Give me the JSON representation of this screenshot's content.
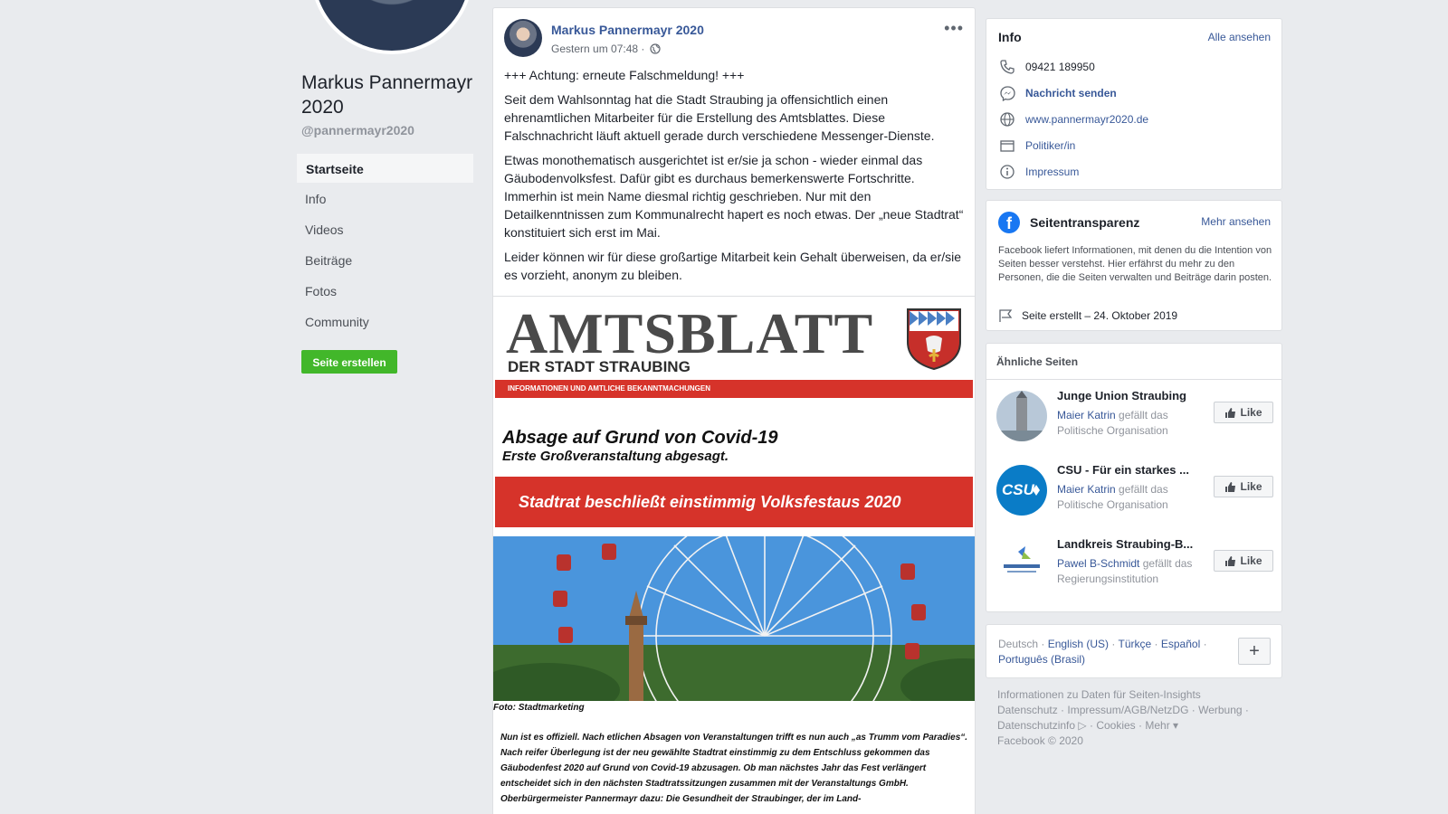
{
  "profile": {
    "name": "Markus Pannermayr 2020",
    "handle": "@pannermayr2020",
    "nav": [
      {
        "label": "Startseite",
        "active": true
      },
      {
        "label": "Info",
        "active": false
      },
      {
        "label": "Videos",
        "active": false
      },
      {
        "label": "Beiträge",
        "active": false
      },
      {
        "label": "Fotos",
        "active": false
      },
      {
        "label": "Community",
        "active": false
      }
    ],
    "create_page_label": "Seite erstellen"
  },
  "post": {
    "author": "Markus Pannermayr 2020",
    "time": "Gestern um 07:48 ·",
    "more_icon": "more-dots-icon",
    "paragraphs": [
      "+++ Achtung: erneute Falschmeldung! +++",
      "Seit dem Wahlsonntag hat die Stadt Straubing ja offensichtlich einen ehrenamtlichen Mitarbeiter für die Erstellung des Amtsblattes. Diese Falschnachricht läuft aktuell gerade durch verschiedene Messenger-Dienste.",
      "Etwas monothematisch ausgerichtet ist er/sie ja schon - wieder einmal das Gäubodenvolksfest. Dafür gibt es durchaus bemerkenswerte Fortschritte. Immerhin ist mein Name diesmal richtig geschrieben. Nur mit den Detailkenntnissen zum Kommunalrecht hapert es noch etwas. Der „neue Stadtrat“ konstituiert sich erst im Mai.",
      "Leider können wir für diese großartige Mitarbeit kein Gehalt überweisen, da er/sie es vorzieht, anonym zu bleiben."
    ],
    "image": {
      "title": "AMTSBLATT",
      "subtitle": "DER STADT STRAUBING",
      "band": "INFORMATIONEN UND AMTLICHE BEKANNTMACHUNGEN",
      "headline": "Absage auf Grund von Covid-19",
      "subline": "Erste Großveranstaltung abgesagt.",
      "banner": "Stadtrat beschließt einstimmig Volksfestaus 2020",
      "caption": "Foto: Stadtmarketing",
      "body": "Nun ist es offiziell. Nach etlichen Absagen von Veranstaltungen trifft es nun auch „as Trumm vom Paradies“. Nach reifer Überlegung ist der neu gewählte Stadtrat einstimmig zu dem Entschluss gekommen das Gäubodenfest 2020 auf Grund von Covid-19 abzusagen. Ob man nächstes Jahr das Fest verlängert entscheidet sich in den nächsten Stadtratssitzungen zusammen mit der Veranstaltungs GmbH. Oberbürgermeister Pannermayr dazu: Die Gesundheit der Straubinger, der im Land-"
    }
  },
  "info": {
    "title": "Info",
    "see_all": "Alle ansehen",
    "rows": [
      {
        "icon": "phone-icon",
        "text": "09421 189950"
      },
      {
        "icon": "messenger-icon",
        "text": "Nachricht senden"
      },
      {
        "icon": "globe-icon",
        "text": "www.pannermayr2020.de"
      },
      {
        "icon": "category-icon",
        "text": "Politiker/in"
      },
      {
        "icon": "info-icon",
        "text": "Impressum"
      }
    ]
  },
  "transparency": {
    "title": "Seitentransparenz",
    "more": "Mehr ansehen",
    "text": "Facebook liefert Informationen, mit denen du die Intention von Seiten besser verstehst. Hier erfährst du mehr zu den Personen, die die Seiten verwalten und Beiträge darin posten.",
    "created": "Seite erstellt – 24. Oktober 2019"
  },
  "similar": {
    "title": "Ähnliche Seiten",
    "like_label": "Like",
    "items": [
      {
        "name": "Junge Union Straubing",
        "who": "Maier Katrin",
        "likes_text": "gefällt das",
        "category": "Politische Organisation"
      },
      {
        "name": "CSU - Für ein starkes ...",
        "who": "Maier Katrin",
        "likes_text": "gefällt das",
        "category": "Politische Organisation"
      },
      {
        "name": "Landkreis Straubing-B...",
        "who": "Pawel B-Schmidt",
        "likes_text": "gefällt das",
        "category": "Regierungsinstitution"
      }
    ]
  },
  "languages": {
    "current": "Deutsch",
    "others": [
      "English (US)",
      "Türkçe",
      "Español",
      "Português (Brasil)"
    ],
    "plus": "+"
  },
  "footer": {
    "links": [
      "Informationen zu Daten für Seiten-Insights",
      "Datenschutz",
      "Impressum/AGB/NetzDG",
      "Werbung",
      "Datenschutzinfo",
      "Cookies",
      "Mehr ▾"
    ],
    "copyright": "Facebook © 2020"
  },
  "colors": {
    "link": "#385898",
    "green": "#42b72a",
    "fb_blue": "#1877f2",
    "red": "#d6332a"
  }
}
